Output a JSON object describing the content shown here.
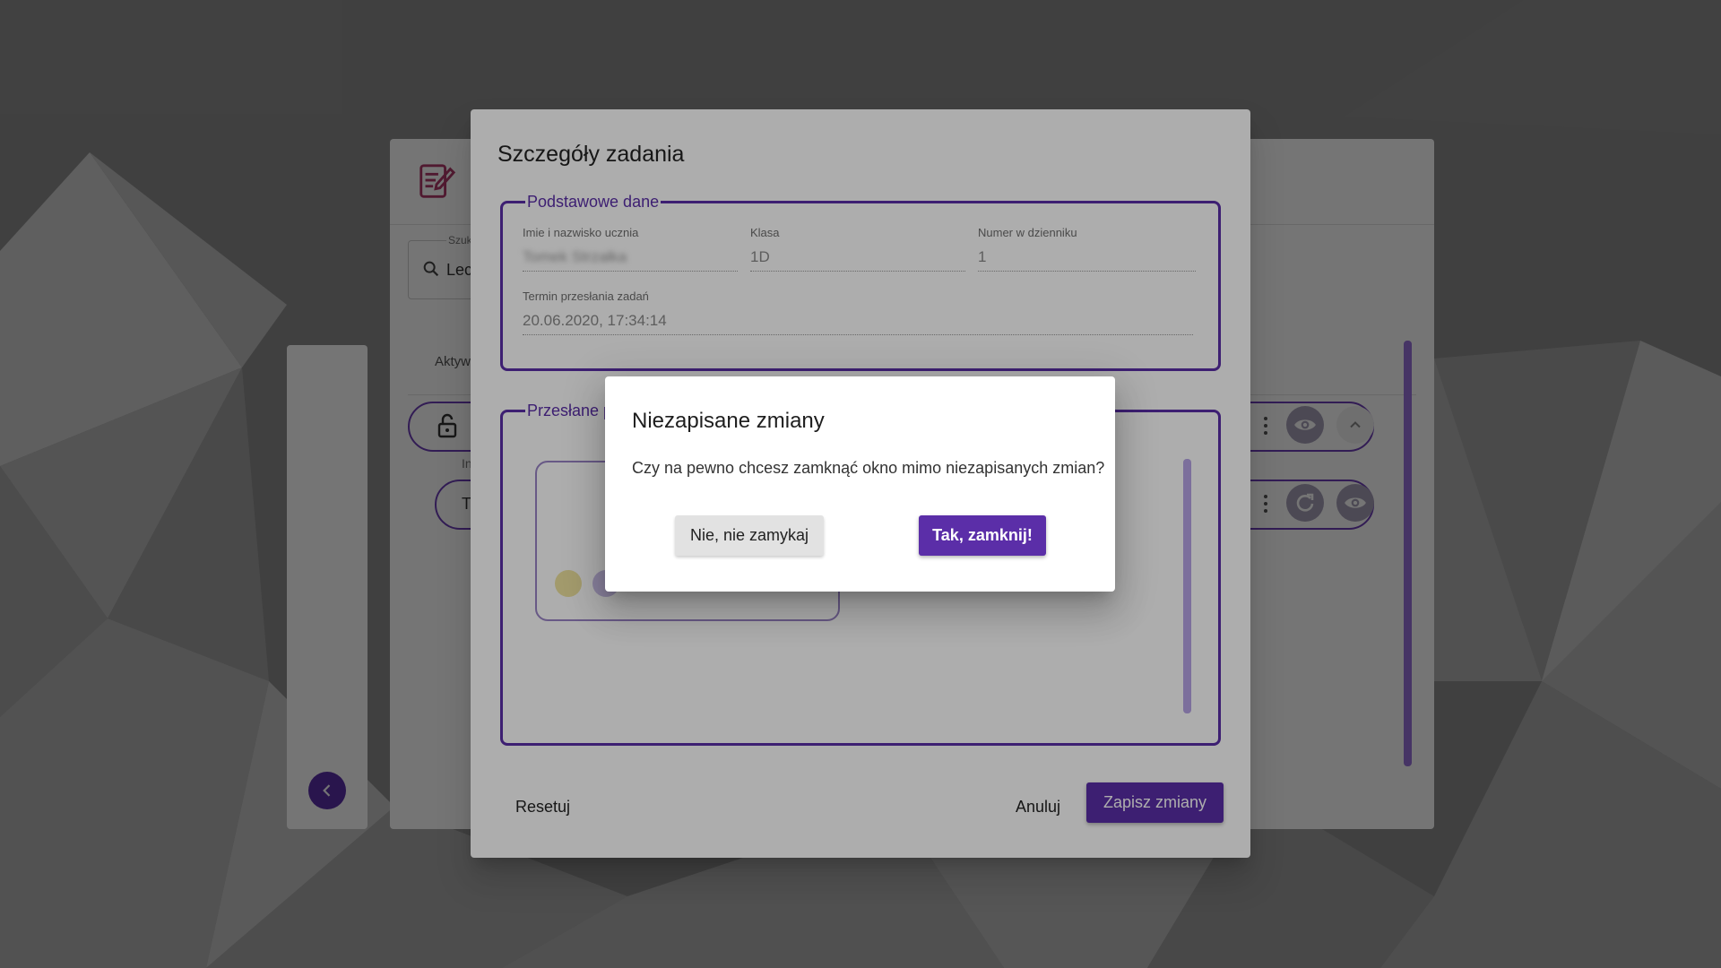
{
  "background_app": {
    "search_label": "Szuk",
    "search_value": "Lec",
    "tab_label": "Aktyw",
    "row_sub_label": "In",
    "row2_text": "T",
    "icons": [
      "edit-document-icon",
      "search-icon",
      "lock-open-icon",
      "more-vert-icon",
      "visibility-icon",
      "expand-less-icon",
      "refresh-icon",
      "chevron-left-icon"
    ]
  },
  "task_dialog": {
    "title": "Szczegóły zadania",
    "basic_section": {
      "legend": "Podstawowe dane",
      "student_label": "Imie i nazwisko ucznia",
      "student_value": "Tomek Strzałka",
      "class_label": "Klasa",
      "class_value": "1D",
      "number_label": "Numer w dzienniku",
      "number_value": "1",
      "deadline_label": "Termin przesłania zadań",
      "deadline_value": "20.06.2020, 17:34:14"
    },
    "files_section": {
      "legend": "Przesłane p"
    },
    "reset_label": "Resetuj",
    "cancel_label": "Anuluj",
    "save_label": "Zapisz zmiany"
  },
  "confirm_dialog": {
    "title": "Niezapisane zmiany",
    "message": "Czy na pewno chcesz zamknąć okno mimo niezapisanych zmian?",
    "no_label": "Nie, nie zamykaj",
    "yes_label": "Tak, zamknij!"
  },
  "colors": {
    "accent": "#5b2ea8",
    "scrim": "rgba(0,0,0,0.32)"
  }
}
